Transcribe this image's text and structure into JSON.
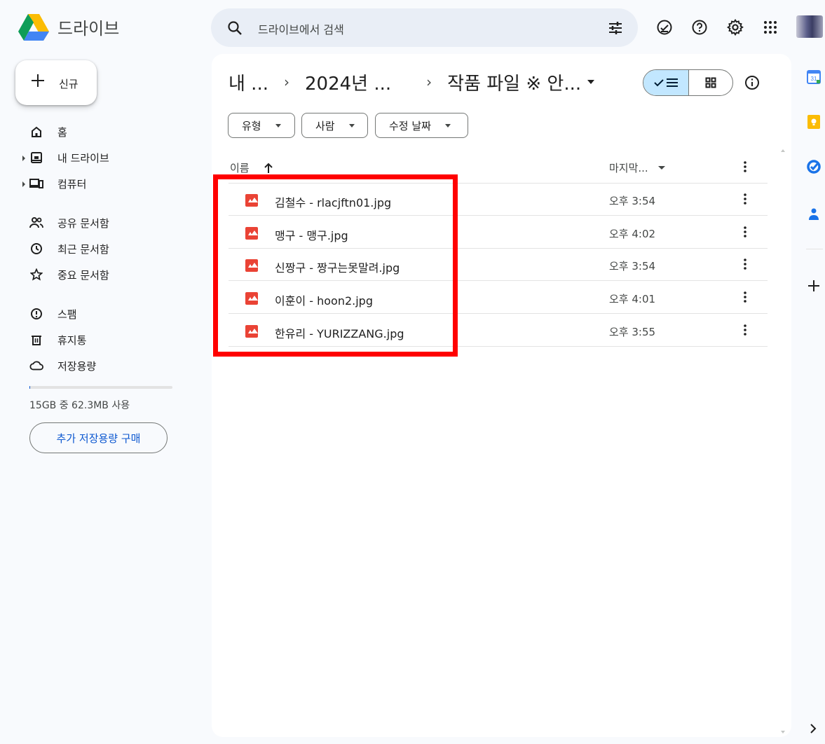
{
  "app": {
    "title": "드라이브"
  },
  "search": {
    "placeholder": "드라이브에서 검색"
  },
  "new_button": {
    "label": "신규"
  },
  "nav": [
    {
      "label": "홈",
      "icon": "home-icon",
      "expandable": false
    },
    {
      "label": "내 드라이브",
      "icon": "my-drive-icon",
      "expandable": true
    },
    {
      "label": "컴퓨터",
      "icon": "computer-icon",
      "expandable": true
    },
    {
      "label": "공유 문서함",
      "icon": "shared-icon",
      "expandable": false
    },
    {
      "label": "최근 문서함",
      "icon": "clock-icon",
      "expandable": false
    },
    {
      "label": "중요 문서함",
      "icon": "star-icon",
      "expandable": false
    },
    {
      "label": "스팸",
      "icon": "spam-icon",
      "expandable": false
    },
    {
      "label": "휴지통",
      "icon": "trash-icon",
      "expandable": false
    },
    {
      "label": "저장용량",
      "icon": "cloud-icon",
      "expandable": false
    }
  ],
  "storage": {
    "text": "15GB 중 62.3MB 사용",
    "used_fraction": 0.004,
    "buy_label": "추가 저장용량 구매"
  },
  "breadcrumb": [
    "내 ...",
    "2024년 ...",
    "작품 파일 ※ 안..."
  ],
  "filters": [
    "유형",
    "사람",
    "수정 날짜"
  ],
  "columns": {
    "name": "이름",
    "modified": "마지막..."
  },
  "files": [
    {
      "name": "김철수 - rlacjftn01.jpg",
      "modified": "오후 3:54"
    },
    {
      "name": "맹구 - 맹구.jpg",
      "modified": "오후 4:02"
    },
    {
      "name": "신짱구 - 짱구는못말려.jpg",
      "modified": "오후 3:54"
    },
    {
      "name": "이훈이 - hoon2.jpg",
      "modified": "오후 4:01"
    },
    {
      "name": "한유리 - YURIZZANG.jpg",
      "modified": "오후 3:55"
    }
  ],
  "colors": {
    "accent": "#0b57d0",
    "view_selected": "#c2e7ff",
    "highlight": "#ff0000",
    "file_icon": "#ea4335"
  },
  "side_apps": [
    "calendar-icon",
    "keep-icon",
    "tasks-icon",
    "contacts-icon"
  ]
}
